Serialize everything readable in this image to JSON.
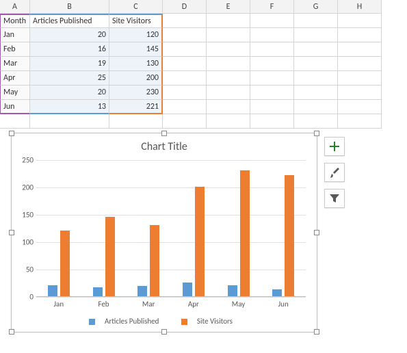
{
  "columns": [
    "A",
    "B",
    "C",
    "D",
    "E",
    "F",
    "G",
    "H"
  ],
  "headers": {
    "A": "Month",
    "B": "Articles Published",
    "C": "Site Visitors"
  },
  "rows": [
    {
      "A": "Jan",
      "B": 20,
      "C": 120
    },
    {
      "A": "Feb",
      "B": 16,
      "C": 145
    },
    {
      "A": "Mar",
      "B": 19,
      "C": 130
    },
    {
      "A": "Apr",
      "B": 25,
      "C": 200
    },
    {
      "A": "May",
      "B": 20,
      "C": 230
    },
    {
      "A": "Jun",
      "B": 13,
      "C": 221
    }
  ],
  "chart_data": {
    "type": "bar",
    "title": "Chart Title",
    "categories": [
      "Jan",
      "Feb",
      "Mar",
      "Apr",
      "May",
      "Jun"
    ],
    "series": [
      {
        "name": "Articles Published",
        "values": [
          20,
          16,
          19,
          25,
          20,
          13
        ],
        "color": "#5b9bd5"
      },
      {
        "name": "Site Visitors",
        "values": [
          120,
          145,
          130,
          200,
          230,
          221
        ],
        "color": "#ed7d31"
      }
    ],
    "xlabel": "",
    "ylabel": "",
    "ylim": [
      0,
      250
    ],
    "yticks": [
      0,
      50,
      100,
      150,
      200,
      250
    ],
    "legend_position": "bottom"
  },
  "tools": {
    "add": "Chart Elements",
    "style": "Chart Styles",
    "filter": "Chart Filters"
  }
}
